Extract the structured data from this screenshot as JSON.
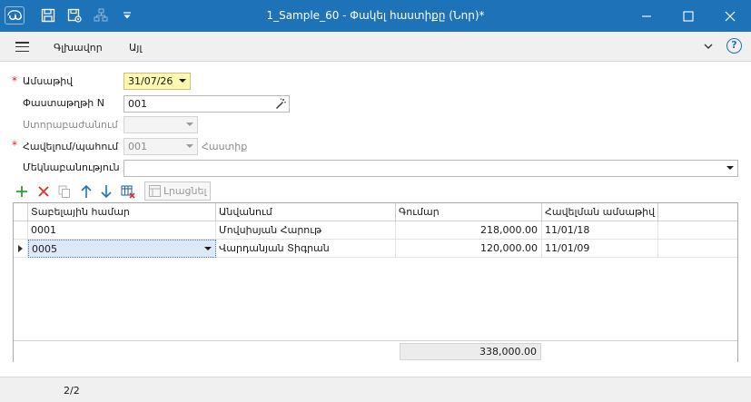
{
  "titlebar": {
    "title": "1_Sample_60 - Փակել հաստիքը (Նոր)*",
    "icons": [
      "app-logo-icon",
      "save-icon",
      "save-settings-icon",
      "hierarchy-icon",
      "quick-access-dropdown-icon"
    ],
    "window_controls": [
      "minimize-icon",
      "maximize-icon",
      "close-icon"
    ]
  },
  "menubar": {
    "items": [
      {
        "label": "Գլխավոր"
      },
      {
        "label": "Այլ"
      }
    ],
    "help_label": "?"
  },
  "form": {
    "date": {
      "label": "Ամսաթիվ",
      "value": "31/07/26",
      "required": true
    },
    "doc_number": {
      "label": "Փաստաթղթի N",
      "value": "001"
    },
    "subdivision": {
      "label": "Ստորաբաժանում",
      "value": ""
    },
    "approval_order": {
      "label": "Հավելում/պահում",
      "value": "001",
      "suffix": "Հաստիք",
      "required": true
    },
    "comment": {
      "label": "Մեկնաբանություն",
      "value": ""
    }
  },
  "toolbar": {
    "tools": [
      "add-icon",
      "delete-icon",
      "copy-icon",
      "move-up-icon",
      "move-down-icon",
      "clear-table-icon"
    ],
    "refresh_label": "Լրացնել"
  },
  "grid": {
    "columns": [
      "Տաբելային համար",
      "Անվանում",
      "Գումար",
      "Հավելման ամսաթիվ"
    ],
    "rows": [
      {
        "tab_no": "0001",
        "name": "Մովսիսյան Հարութ",
        "amount": "218,000.00",
        "date": "11/01/18"
      },
      {
        "tab_no": "0005",
        "name": "Վարդանյան Տիգրան",
        "amount": "120,000.00",
        "date": "11/01/09"
      }
    ],
    "total": "338,000.00"
  },
  "status": {
    "record_position": "2/2"
  },
  "colors": {
    "titlebar": "#1e72b8",
    "required": "#e0202a",
    "date_field": "#fcf8b1",
    "add_icon": "#2a9d3a",
    "delete_icon": "#d9302c",
    "arrow_icon": "#1e72b8"
  }
}
